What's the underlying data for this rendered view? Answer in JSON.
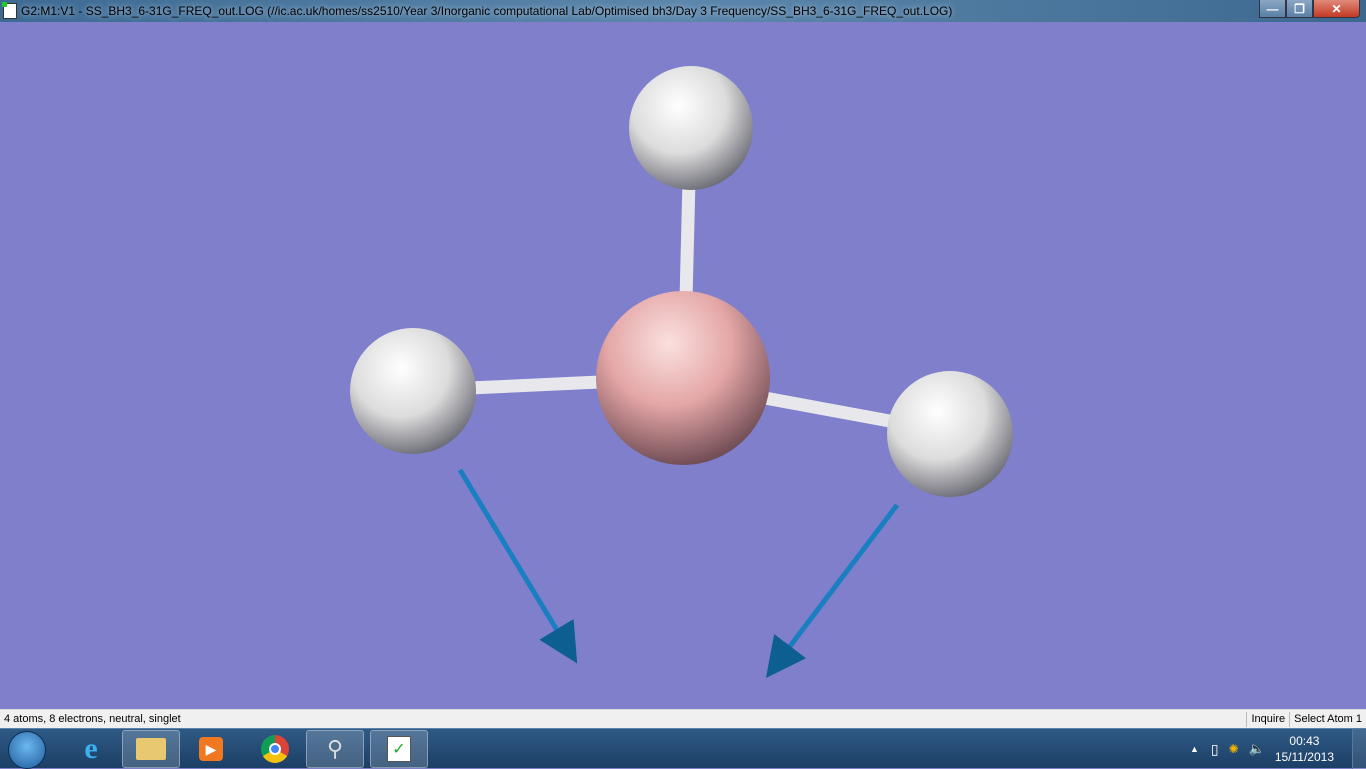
{
  "window": {
    "title": "G2:M1:V1 - SS_BH3_6-31G_FREQ_out.LOG (//ic.ac.uk/homes/ss2510/Year 3/Inorganic computational Lab/Optimised bh3/Day 3 Frequency/SS_BH3_6-31G_FREQ_out.LOG)",
    "minimize": "—",
    "maximize": "❐",
    "close": "✕"
  },
  "viewport": {
    "background": "#7f7fcc",
    "atoms": [
      {
        "element": "B",
        "color": "#e8a8a8"
      },
      {
        "element": "H",
        "color": "#f0f0f0"
      },
      {
        "element": "H",
        "color": "#f0f0f0"
      },
      {
        "element": "H",
        "color": "#f0f0f0"
      }
    ],
    "displacement_color": "#1a7fc0"
  },
  "status": {
    "message": "4 atoms, 8 electrons, neutral, singlet",
    "mode": "Inquire",
    "prompt": "Select Atom 1"
  },
  "taskbar": {
    "time": "00:43",
    "date": "15/11/2013",
    "tray_arrow": "▲",
    "tray_icons": [
      "power-icon",
      "network-icon",
      "volume-icon"
    ]
  }
}
